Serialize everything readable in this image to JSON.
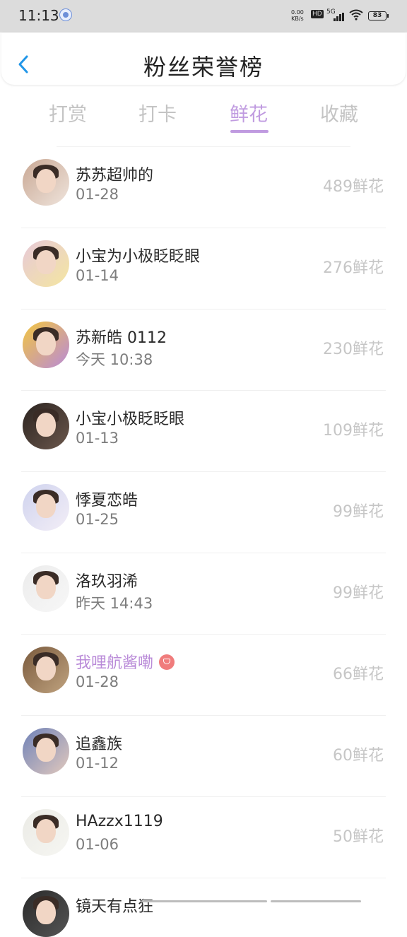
{
  "status_bar": {
    "time": "11:13",
    "net_speed_value": "0.00",
    "net_speed_unit": "KB/s",
    "hd": "HD",
    "network": "5G",
    "battery": "83"
  },
  "header": {
    "title": "粉丝荣誉榜"
  },
  "tabs": [
    {
      "label": "打赏",
      "active": false
    },
    {
      "label": "打卡",
      "active": false
    },
    {
      "label": "鲜花",
      "active": true
    },
    {
      "label": "收藏",
      "active": false
    }
  ],
  "rows": [
    {
      "name": "苏苏超帅的",
      "date": "01-28",
      "score": "489鲜花",
      "avatar_colors": [
        "#c9a894",
        "#efe4dc"
      ]
    },
    {
      "name": "小宝为小极眨眨眼",
      "date": "01-14",
      "score": "276鲜花",
      "avatar_colors": [
        "#e7c9d8",
        "#f4e6a0"
      ]
    },
    {
      "name": "苏新皓 0112",
      "date": "今天 10:38",
      "score": "230鲜花",
      "avatar_colors": [
        "#f2c640",
        "#b98ad8"
      ]
    },
    {
      "name": "小宝小极眨眨眼",
      "date": "01-13",
      "score": "109鲜花",
      "avatar_colors": [
        "#2b2420",
        "#6b574c"
      ]
    },
    {
      "name": "悸夏恋皓",
      "date": "01-25",
      "score": "99鲜花",
      "avatar_colors": [
        "#cfd3ee",
        "#f3eef7"
      ]
    },
    {
      "name": "洛玖羽浠",
      "date": "昨天 14:43",
      "score": "99鲜花",
      "avatar_colors": [
        "#ececec",
        "#f7f7f7"
      ]
    },
    {
      "name": "我哩航酱嘞",
      "date": "01-28",
      "score": "66鲜花",
      "avatar_colors": [
        "#7a5a3d",
        "#c0a37f"
      ],
      "highlight": true,
      "badge": "gem-badge-icon"
    },
    {
      "name": "追鑫族",
      "date": "01-12",
      "score": "60鲜花",
      "avatar_colors": [
        "#6f82b8",
        "#e2c9bd"
      ]
    },
    {
      "name": "HAzzx1119",
      "date": "01-06",
      "score": "50鲜花",
      "avatar_colors": [
        "#ebebe6",
        "#f6f6f2"
      ]
    },
    {
      "name": "镜天有点狂",
      "date": "",
      "score": "",
      "avatar_colors": [
        "#2a2a2a",
        "#555555"
      ]
    }
  ],
  "colors": {
    "accent": "#c09be0",
    "inactive_tab": "#c4c4c4",
    "score": "#c6c6c6",
    "back_arrow": "#2196e8"
  }
}
